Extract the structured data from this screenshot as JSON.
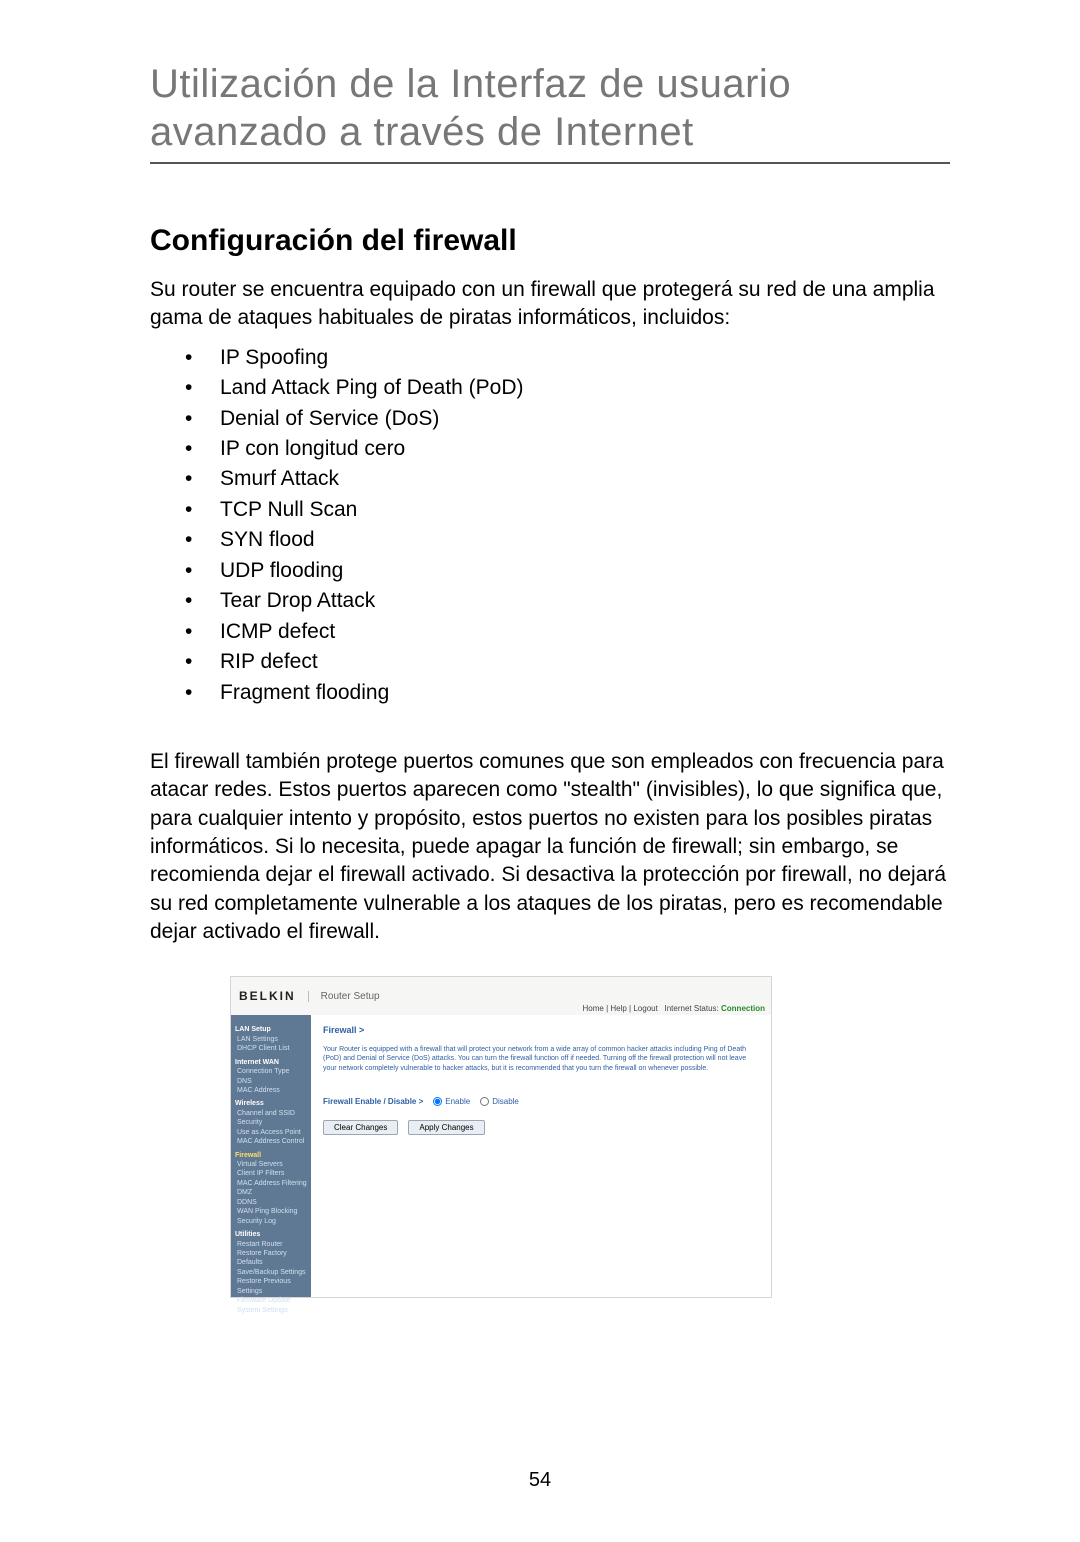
{
  "page": {
    "title": "Utilización de la Interfaz de usuario avanzado a través de Internet",
    "number": "54"
  },
  "firewall": {
    "heading": "Configuración del firewall",
    "intro": "Su router se encuentra equipado con un firewall que protegerá su red de una amplia gama de ataques habituales de piratas informáticos, incluidos:",
    "attacks": [
      "IP Spoofing",
      "Land Attack Ping of Death (PoD)",
      "Denial of Service (DoS)",
      "IP con longitud cero",
      "Smurf Attack",
      "TCP Null Scan",
      "SYN flood",
      "UDP flooding",
      "Tear Drop Attack",
      "ICMP defect",
      "RIP defect",
      "Fragment flooding"
    ],
    "para2": "El firewall también protege puertos comunes que son empleados con frecuencia para atacar redes. Estos puertos aparecen como \"stealth\" (invisibles), lo que significa que, para cualquier intento y propósito, estos puertos no existen para los posibles piratas informáticos. Si lo necesita, puede apagar la función de firewall; sin embargo, se recomienda dejar el firewall activado. Si desactiva la protección por firewall, no dejará su red completamente vulnerable a los ataques de los piratas, pero es recomendable dejar activado el firewall."
  },
  "router": {
    "brand": "BELKIN",
    "subtitle": "Router Setup",
    "topLinks": {
      "home": "Home",
      "help": "Help",
      "logout": "Logout",
      "statusLabel": "Internet Status:",
      "statusValue": "Connection"
    },
    "sidebar": {
      "groups": [
        {
          "label": "LAN Setup",
          "items": [
            "LAN Settings",
            "DHCP Client List"
          ]
        },
        {
          "label": "Internet WAN",
          "items": [
            "Connection Type",
            "DNS",
            "MAC Address"
          ]
        },
        {
          "label": "Wireless",
          "items": [
            "Channel and SSID",
            "Security",
            "Use as Access Point",
            "MAC Address Control"
          ]
        },
        {
          "label": "Firewall",
          "selected": true,
          "items": [
            "Virtual Servers",
            "Client IP Filters",
            "MAC Address Filtering",
            "DMZ",
            "DDNS",
            "WAN Ping Blocking",
            "Security Log"
          ]
        },
        {
          "label": "Utilities",
          "items": [
            "Restart Router",
            "Restore Factory Defaults",
            "Save/Backup Settings",
            "Restore Previous Settings",
            "Firmware Update",
            "System Settings"
          ]
        }
      ]
    },
    "main": {
      "crumb": "Firewall >",
      "desc": "Your Router is equipped with a firewall that will protect your network from a wide array of common hacker attacks including Ping of Death (PoD) and Denial of Service (DoS) attacks. You can turn the firewall function off if needed. Turning off the firewall protection will not leave your network completely vulnerable to hacker attacks, but it is recommended that you turn the firewall on whenever possible.",
      "toggleLabel": "Firewall Enable / Disable >",
      "enable": "Enable",
      "disable": "Disable",
      "clear": "Clear Changes",
      "apply": "Apply Changes"
    }
  }
}
